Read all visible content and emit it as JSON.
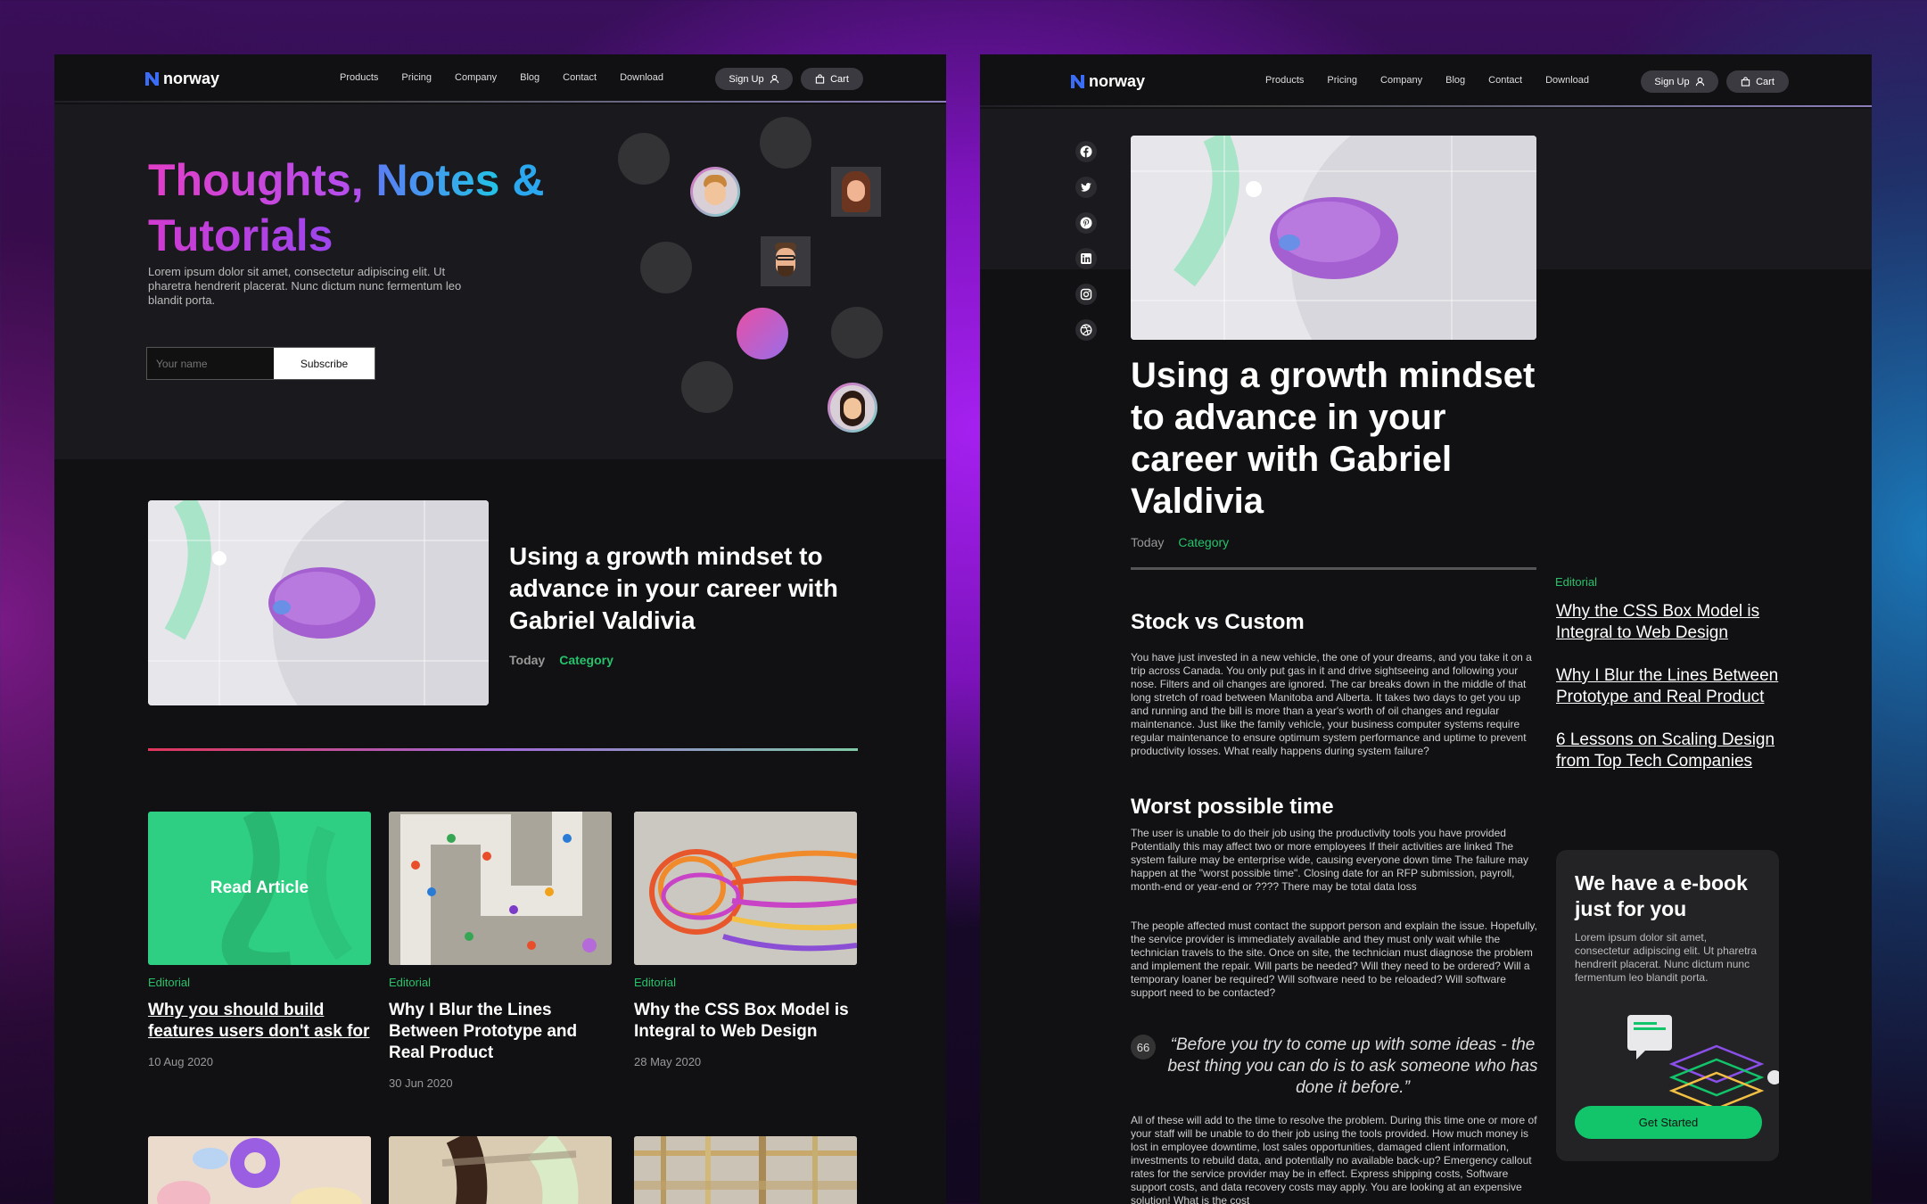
{
  "nav": {
    "brand": "norway",
    "links": [
      "Products",
      "Pricing",
      "Company",
      "Blog",
      "Contact",
      "Download"
    ],
    "signup_label": "Sign Up",
    "cart_label": "Cart"
  },
  "hero": {
    "title_part1": "Thoughts,",
    "title_part2": "Notes",
    "title_part3": "&",
    "title_part4": "Tutorials",
    "description": "Lorem ipsum dolor sit amet, consectetur adipiscing elit. Ut pharetra hendrerit placerat. Nunc dictum nunc fermentum leo blandit porta.",
    "input_placeholder": "Your name",
    "subscribe_label": "Subscribe"
  },
  "featured": {
    "title": "Using a growth mindset to advance in your career with Gabriel Valdivia",
    "date": "Today",
    "category": "Category"
  },
  "cards": [
    {
      "tag": "Editorial",
      "title": "Why you should build features users don't ask for",
      "date": "10 Aug 2020",
      "overlay": "Read Article"
    },
    {
      "tag": "Editorial",
      "title": "Why I Blur the Lines Between Prototype and Real Product",
      "date": "30 Jun 2020"
    },
    {
      "tag": "Editorial",
      "title": "Why the CSS Box Model is Integral to Web Design",
      "date": "28 May 2020"
    }
  ],
  "article": {
    "title": "Using a growth mindset to advance in your career with Gabriel Valdivia",
    "date": "Today",
    "category": "Category",
    "h1": "Stock vs Custom",
    "p1": "You have just invested in a new vehicle, the one of your dreams, and you take it on a trip across Canada. You only put gas in it and drive sightseeing and following your nose. Filters and oil changes are ignored. The car breaks down in the middle of that long stretch of road between Manitoba and Alberta. It takes two days to get you up and running and the bill is more than a year's worth of oil changes and regular maintenance. Just like the family vehicle, your business computer systems require regular maintenance to ensure optimum system performance and uptime to prevent productivity losses. What really happens during system failure?",
    "h2": "Worst possible time",
    "p2": "The user is unable to do their job using the productivity tools you have provided Potentially this may affect two or more employees If their activities are linked The system failure may be enterprise wide, causing everyone down time The failure may happen at the \"worst possible time\". Closing date for an RFP submission, payroll, month-end or year-end or ???? There may be total data loss",
    "p3": "The people affected must contact the support person and explain the issue. Hopefully, the service provider is immediately available and they must only wait while the technician travels to the site. Once on site, the technician must diagnose the problem and implement the repair. Will parts be needed? Will they need to be ordered? Will a temporary loaner be required? Will software need to be reloaded? Will software support need to be contacted?",
    "quote_mark": "66",
    "quote": "“Before you try to come up with some ideas - the best thing you can do is to ask someone who has done it before.”",
    "p4": "All of these will add to the time to resolve the problem. During this time one or more of your staff will be unable to do their job using the tools provided. How much money is lost in employee downtime, lost sales opportunities, damaged client information, investments to rebuild data, and potentially no available back-up? Emergency callout rates for the service provider may be in effect. Express shipping costs, Software support costs, and data recovery costs may apply. You are looking at an expensive solution! What is the cost"
  },
  "sidebar": {
    "tag": "Editorial",
    "links": [
      "Why the CSS Box Model is Integral to Web Design",
      "Why I Blur the Lines Between Prototype and Real Product",
      "6 Lessons on Scaling Design from Top Tech Companies"
    ],
    "ebook_title": "We have a e-book just for you",
    "ebook_desc": "Lorem ipsum dolor sit amet, consectetur adipiscing elit. Ut pharetra hendrerit placerat. Nunc dictum nunc fermentum leo blandit porta.",
    "ebook_button": "Get Started"
  },
  "colors": {
    "accent_green": "#27c26b",
    "button_green": "#12c46a",
    "panel_bg": "#111113"
  }
}
